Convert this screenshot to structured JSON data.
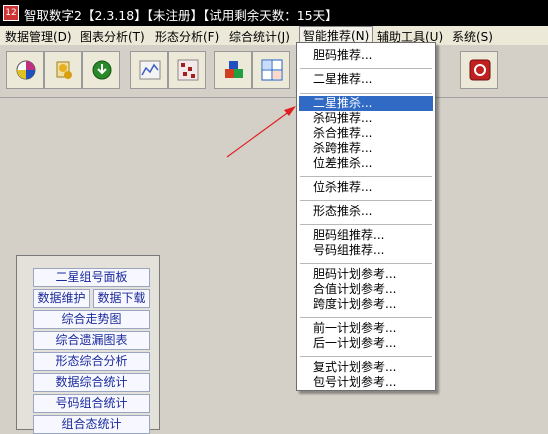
{
  "titlebar": {
    "title": "智取数字2【2.3.18】【未注册】【试用剩余天数：15天】",
    "icon_text": "12"
  },
  "menubar": {
    "items": [
      {
        "label": "数据管理(D)"
      },
      {
        "label": "图表分析(T)"
      },
      {
        "label": "形态分析(F)"
      },
      {
        "label": "综合统计(J)"
      },
      {
        "label": "智能推荐(N)"
      },
      {
        "label": "辅助工具(U)"
      },
      {
        "label": "系统(S)"
      }
    ]
  },
  "toolbar": {
    "buttons": [
      {
        "icon": "palette-icon",
        "color": "#c03080"
      },
      {
        "icon": "coins-icon",
        "color": "#c8a020"
      },
      {
        "icon": "download-globe-icon",
        "color": "#2a8a2a"
      },
      {
        "icon": "line-chart-icon",
        "color": "#4060c0"
      },
      {
        "icon": "grid-chart-icon",
        "color": "#a02020"
      },
      {
        "icon": "blocks-icon",
        "color": "#d04020"
      },
      {
        "icon": "number-table-icon",
        "color": "#2060c0"
      },
      {
        "icon": "record-icon",
        "color": "#c02020"
      }
    ]
  },
  "dropdown": {
    "items": [
      "胆码推荐...",
      "二星推荐...",
      "二星推杀...",
      "杀码推荐...",
      "杀合推荐...",
      "杀跨推荐...",
      "位差推杀...",
      "位杀推荐...",
      "形态推杀...",
      "胆码组推荐...",
      "号码组推荐...",
      "胆码计划参考...",
      "合值计划参考...",
      "跨度计划参考...",
      "前一计划参考...",
      "后一计划参考...",
      "复式计划参考...",
      "包号计划参考..."
    ],
    "highlighted": "二星推杀..."
  },
  "panel": {
    "buttons": [
      "二星组号面板",
      "数据维护",
      "数据下载",
      "综合走势图",
      "综合遗漏图表",
      "形态综合分析",
      "数据综合统计",
      "号码组合统计",
      "组合态统计"
    ]
  },
  "colors": {
    "highlight": "#316ac5",
    "arrow": "#e02020",
    "panel_text": "#1a2a9c"
  }
}
